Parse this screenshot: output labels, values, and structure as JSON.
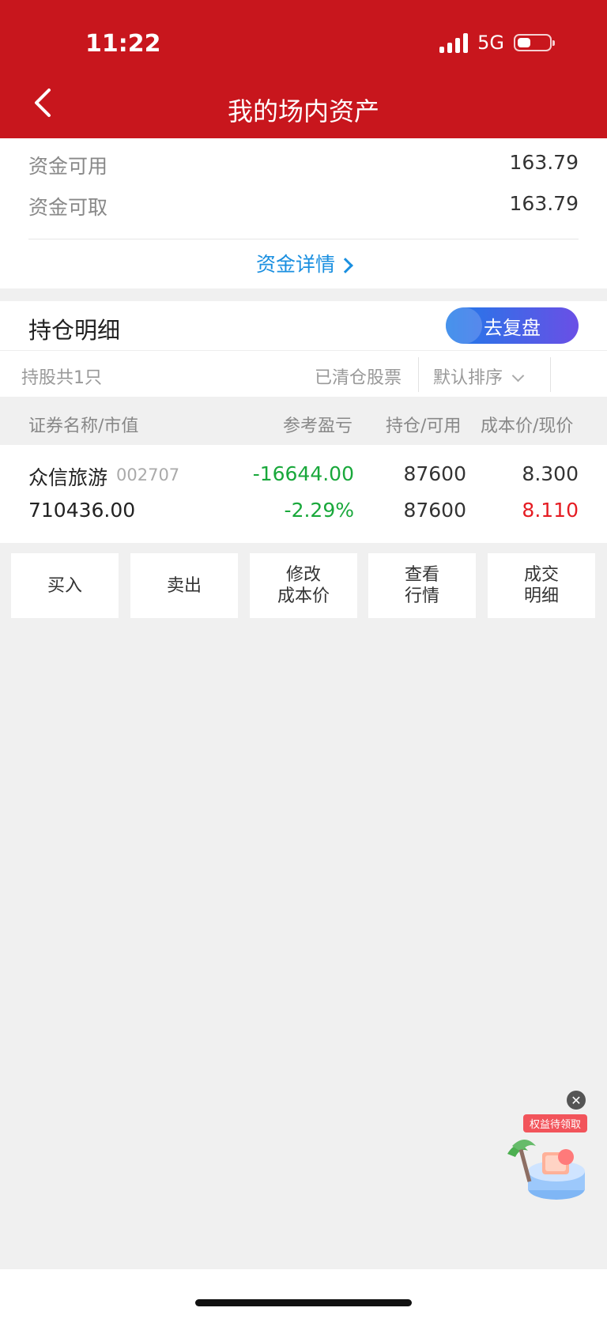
{
  "status": {
    "time": "11:22",
    "network": "5G"
  },
  "header": {
    "title": "我的场内资产"
  },
  "funds": {
    "available_label": "资金可用",
    "available_value": "163.79",
    "withdrawable_label": "资金可取",
    "withdrawable_value": "163.79",
    "detail_link": "资金详情"
  },
  "holdings": {
    "title": "持仓明细",
    "review_button": "去复盘",
    "count_label": "持股共1只",
    "cleared_label": "已清仓股票",
    "sort_label": "默认排序",
    "columns": [
      "证券名称/市值",
      "参考盈亏",
      "持仓/可用",
      "成本价/现价"
    ],
    "rows": [
      {
        "name": "众信旅游",
        "code": "002707",
        "market_value": "710436.00",
        "pnl": "-16644.00",
        "pnl_pct": "-2.29%",
        "position": "87600",
        "available": "87600",
        "cost": "8.300",
        "price": "8.110"
      }
    ]
  },
  "actions": [
    {
      "label": "买入"
    },
    {
      "label": "卖出"
    },
    {
      "label": "修改\n成本价"
    },
    {
      "label": "查看\n行情"
    },
    {
      "label": "成交\n明细"
    }
  ],
  "floating": {
    "badge": "权益待领取",
    "close_icon": "close-icon"
  },
  "colors": {
    "header": "#c8161d",
    "loss": "#19a83b",
    "gain": "#e51c23",
    "link": "#1a8fe0"
  }
}
